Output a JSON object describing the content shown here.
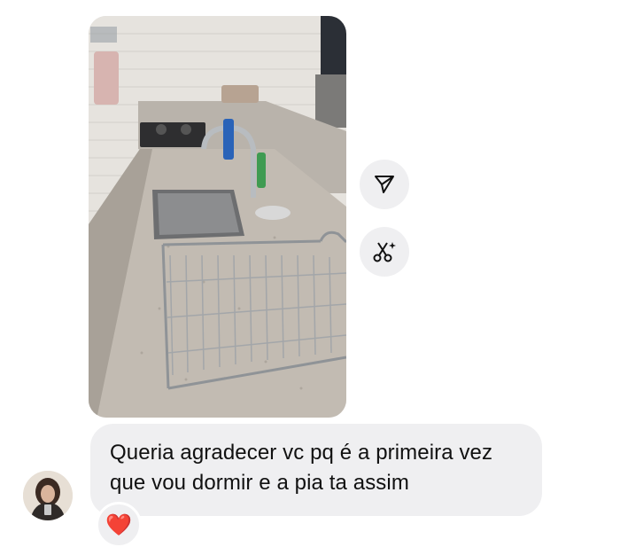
{
  "message": {
    "text": "Queria agradecer vc pq é a primeira vez que vou dormir e a pia ta assim",
    "reaction_glyph": "❤️",
    "reaction_icon": "heart-icon"
  },
  "photo": {
    "description_icon": "kitchen-photo"
  },
  "actions": {
    "share_icon": "send-icon",
    "remix_icon": "scissors-sparkle-icon"
  },
  "colors": {
    "bubble": "#efeff1",
    "text": "#111111",
    "heart": "#e0245e"
  }
}
